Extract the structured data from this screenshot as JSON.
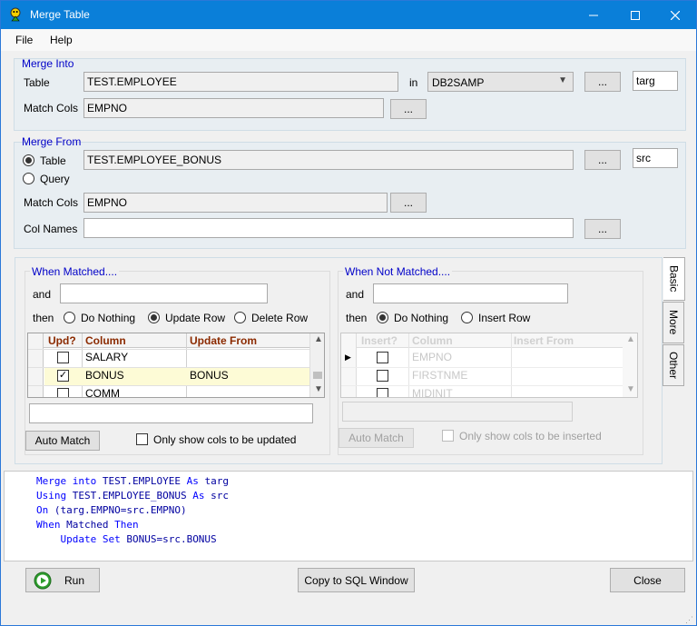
{
  "window": {
    "title": "Merge Table"
  },
  "menu": {
    "file": "File",
    "help": "Help"
  },
  "merge_into": {
    "title": "Merge Into",
    "table_label": "Table",
    "table_value": "TEST.EMPLOYEE",
    "in_label": "in",
    "database": "DB2SAMP",
    "browse": "...",
    "alias": "targ",
    "match_label": "Match Cols",
    "match_value": "EMPNO",
    "match_browse": "..."
  },
  "merge_from": {
    "title": "Merge From",
    "table_label": "Table",
    "query_label": "Query",
    "table_value": "TEST.EMPLOYEE_BONUS",
    "browse": "...",
    "alias": "src",
    "match_label": "Match Cols",
    "match_value": "EMPNO",
    "match_browse": "...",
    "colnames_label": "Col Names",
    "colnames_value": "",
    "colnames_browse": "..."
  },
  "when_matched": {
    "title": "When Matched....",
    "and_label": "and",
    "and_value": "",
    "then_label": "then",
    "opt_nothing": "Do Nothing",
    "opt_update": "Update Row",
    "opt_delete": "Delete Row",
    "headers": [
      "Upd?",
      "Column",
      "Update From"
    ],
    "rows": [
      {
        "checked": false,
        "column": "SALARY",
        "from": ""
      },
      {
        "checked": true,
        "column": "BONUS",
        "from": "BONUS"
      },
      {
        "checked": false,
        "column": "COMM",
        "from": ""
      }
    ],
    "auto_match": "Auto Match",
    "only_show": "Only show cols to be updated"
  },
  "when_not_matched": {
    "title": "When Not Matched....",
    "and_label": "and",
    "and_value": "",
    "then_label": "then",
    "opt_nothing": "Do Nothing",
    "opt_insert": "Insert Row",
    "headers": [
      "Insert?",
      "Column",
      "Insert From"
    ],
    "rows": [
      {
        "column": "EMPNO"
      },
      {
        "column": "FIRSTNME"
      },
      {
        "column": "MIDINIT"
      }
    ],
    "auto_match": "Auto Match",
    "only_show": "Only show cols to be inserted"
  },
  "side_tabs": {
    "basic": "Basic",
    "more": "More",
    "other": "Other"
  },
  "sql": {
    "l1a": "Merge into",
    "l1b": " TEST.EMPLOYEE ",
    "l1c": "As",
    "l1d": " targ",
    "l2a": "Using",
    "l2b": " TEST.EMPLOYEE_BONUS ",
    "l2c": "As",
    "l2d": " src",
    "l3a": "On",
    "l3b": " (targ.EMPNO=src.EMPNO)",
    "l4a": "When",
    "l4b": " Matched ",
    "l4c": "Then",
    "l5a": "    Update Set",
    "l5b": " BONUS=src.BONUS"
  },
  "buttons": {
    "run": "Run",
    "copy": "Copy to SQL Window",
    "close": "Close"
  }
}
